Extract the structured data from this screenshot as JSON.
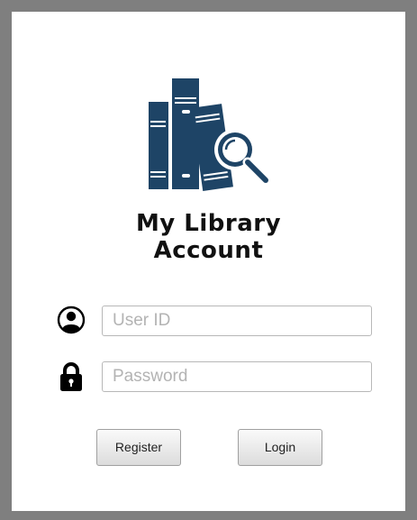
{
  "app": {
    "title_line1": "My Library",
    "title_line2": "Account"
  },
  "logo": {
    "icon": "books-magnifier-icon",
    "color": "#1e4466"
  },
  "form": {
    "user_icon": "user-circle-icon",
    "user_placeholder": "User ID",
    "user_value": "",
    "password_icon": "lock-icon",
    "password_placeholder": "Password",
    "password_value": ""
  },
  "buttons": {
    "register_label": "Register",
    "login_label": "Login"
  }
}
